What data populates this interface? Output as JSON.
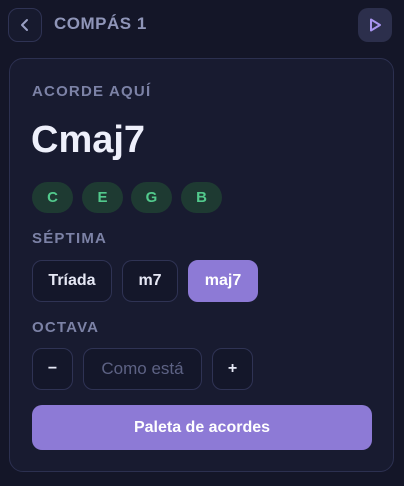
{
  "header": {
    "title": "COMPÁS 1",
    "back_icon": "chevron-left-icon",
    "play_icon": "play-icon"
  },
  "chord": {
    "section_label": "ACORDE AQUÍ",
    "name": "Cmaj7",
    "notes": [
      "C",
      "E",
      "G",
      "B"
    ]
  },
  "seventh": {
    "label": "SÉPTIMA",
    "options": [
      "Tríada",
      "m7",
      "maj7"
    ],
    "selected": "maj7"
  },
  "octave": {
    "label": "OCTAVA",
    "decrement_label": "−",
    "value": "Como está",
    "increment_label": "+"
  },
  "palette_button": "Paleta de acordes",
  "colors": {
    "background": "#141628",
    "card": "#181b30",
    "accent": "#8d7ad6",
    "note_pill_bg": "#1e3a32",
    "note_pill_text": "#52c98c"
  }
}
